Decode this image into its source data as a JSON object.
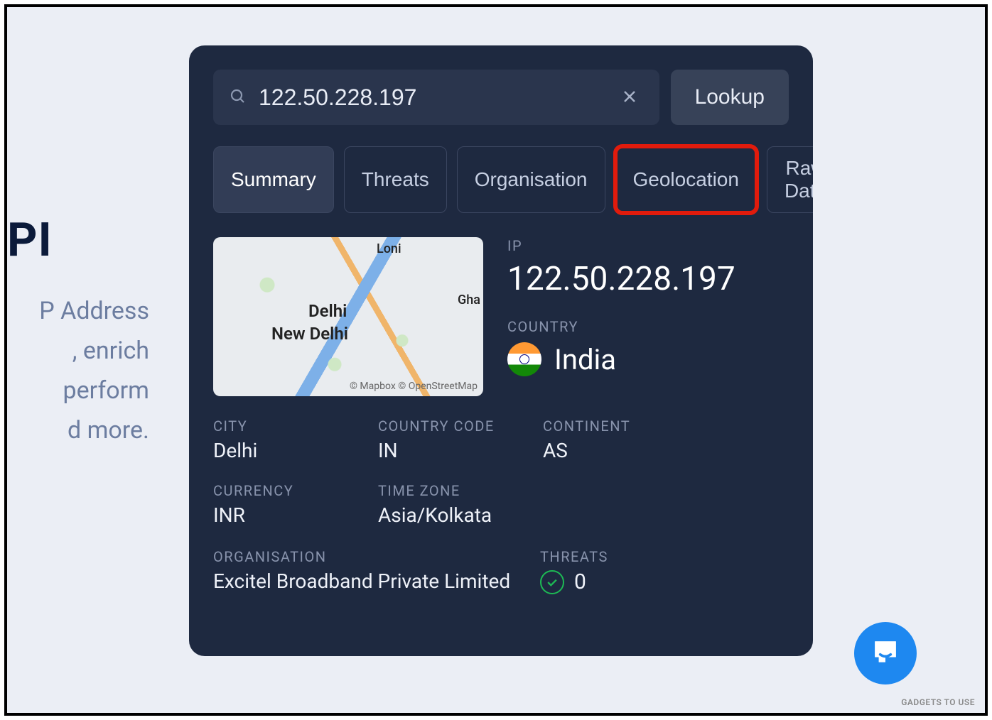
{
  "bg": {
    "title": "PI",
    "lines": [
      "P Address",
      ", enrich",
      " perform",
      "d more."
    ]
  },
  "search": {
    "value": "122.50.228.197",
    "lookup_label": "Lookup"
  },
  "tabs": {
    "summary": "Summary",
    "threats": "Threats",
    "organisation": "Organisation",
    "geolocation": "Geolocation",
    "rawdata": "Raw Data"
  },
  "map": {
    "city_primary": "Delhi",
    "city_secondary": "New Delhi",
    "city_top": "Loni",
    "city_right": "Gha",
    "attrib": "© Mapbox © OpenStreetMap"
  },
  "info": {
    "ip_label": "IP",
    "ip_value": "122.50.228.197",
    "country_label": "COUNTRY",
    "country_name": "India"
  },
  "details": {
    "city_label": "CITY",
    "city_value": "Delhi",
    "countrycode_label": "COUNTRY CODE",
    "countrycode_value": "IN",
    "continent_label": "CONTINENT",
    "continent_value": "AS",
    "currency_label": "CURRENCY",
    "currency_value": "INR",
    "timezone_label": "TIME ZONE",
    "timezone_value": "Asia/Kolkata",
    "org_label": "ORGANISATION",
    "org_value": "Excitel Broadband Private Limited",
    "threats_label": "THREATS",
    "threats_value": "0"
  },
  "watermark": "GADGETS TO USE"
}
